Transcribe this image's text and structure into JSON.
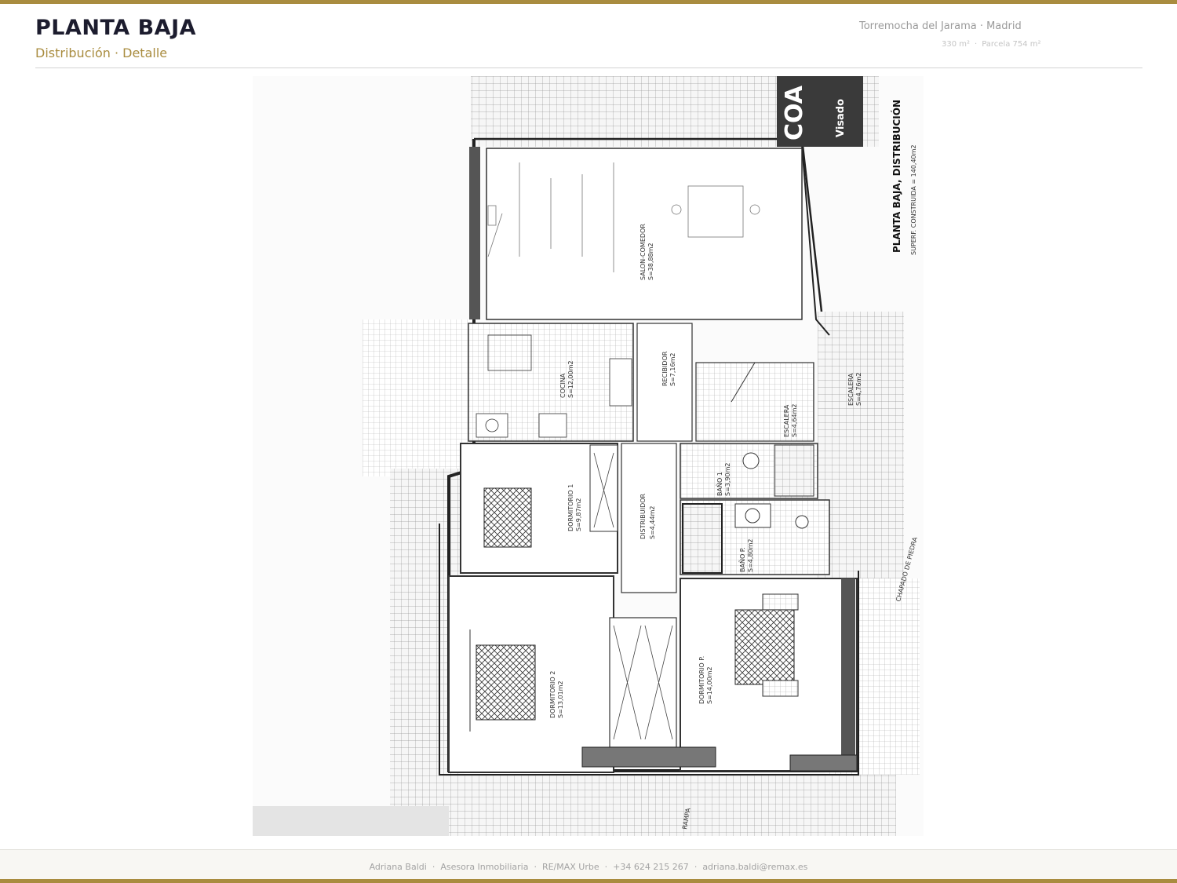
{
  "header": {
    "title": "PLANTA BAJA",
    "subtitle": "Distribución · Detalle",
    "location": "Torremocha del Jarama · Madrid",
    "area": "330 m²",
    "plot": "Parcela 754 m²"
  },
  "plan": {
    "stamp": "COA",
    "stamp_sub": "Visado",
    "heading": "PLANTA BAJA, DISTRIBUCIÓN",
    "total_area": "SUPERF. CONSTRUIDA = 140,40m2",
    "rooms": [
      {
        "name": "SALON-COMEDOR",
        "area": "S=38,88m2"
      },
      {
        "name": "COCINA",
        "area": "S=12,00m2"
      },
      {
        "name": "RECIBIDOR",
        "area": "S=7,16m2"
      },
      {
        "name": "ESCALERA",
        "area": "S=4,64m2"
      },
      {
        "name": "BAÑO 1",
        "area": "S=3,90m2"
      },
      {
        "name": "DORMITORIO 1",
        "area": "S=9,87m2"
      },
      {
        "name": "DISTRIBUIDOR",
        "area": "S=4,44m2"
      },
      {
        "name": "BAÑO P.",
        "area": "S=4,80m2"
      },
      {
        "name": "DORMITORIO 2",
        "area": "S=13,01m2"
      },
      {
        "name": "DORMITORIO P.",
        "area": "S=14,00m2"
      },
      {
        "name": "ESCALERA",
        "area": "S=4,76m2"
      }
    ],
    "annotations": {
      "chapado": "CHAPADO DE PIEDRA",
      "rampa": "RAMPA"
    }
  },
  "footer": {
    "name": "Adriana Baldi",
    "role": "Asesora Inmobiliaria",
    "agency": "RE/MAX Urbe",
    "phone": "+34 624 215 267",
    "email": "adriana.baldi@remax.es"
  }
}
